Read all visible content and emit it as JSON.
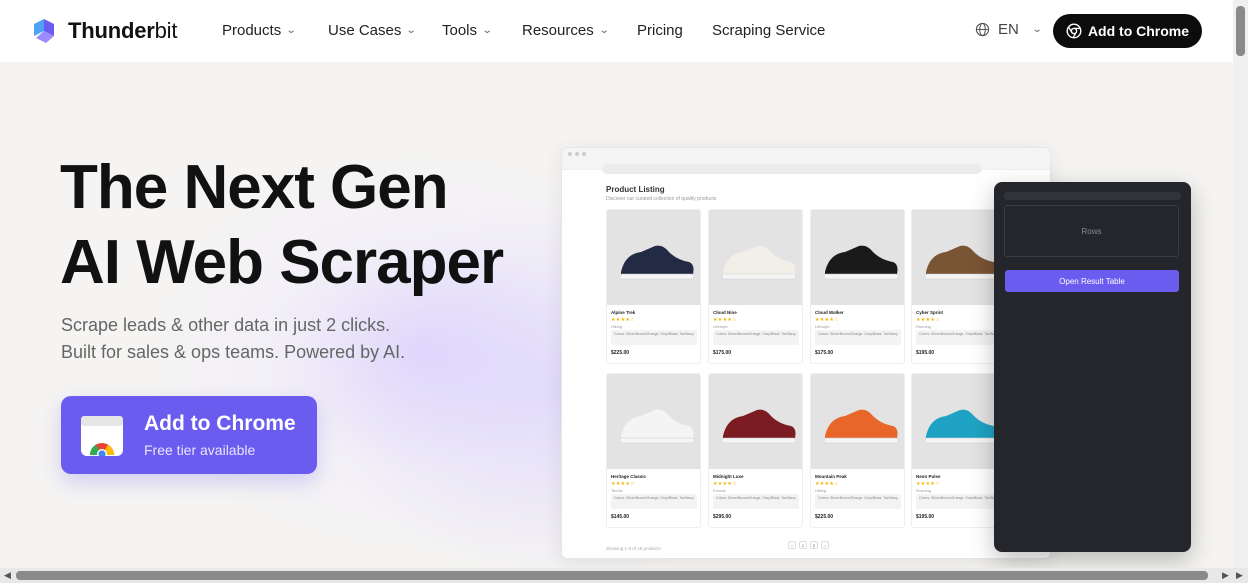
{
  "nav": {
    "brand_bold": "Thunder",
    "brand_light": "bit",
    "items": [
      {
        "label": "Products",
        "dropdown": true
      },
      {
        "label": "Use Cases",
        "dropdown": true
      },
      {
        "label": "Tools",
        "dropdown": true
      },
      {
        "label": "Resources",
        "dropdown": true
      },
      {
        "label": "Pricing",
        "dropdown": false
      },
      {
        "label": "Scraping Service",
        "dropdown": false
      }
    ],
    "language": "EN",
    "cta_label": "Add to Chrome"
  },
  "hero": {
    "title_line1": "The Next Gen",
    "title_line2": "AI Web Scraper",
    "subtitle_line1": "Scrape leads & other data in just 2 clicks.",
    "subtitle_line2": "Built for sales & ops teams. Powered by AI.",
    "cta_title": "Add to Chrome",
    "cta_subtitle": "Free tier available"
  },
  "mock": {
    "title": "Product Listing",
    "description": "Discover our curated collection of quality products",
    "products": [
      {
        "name": "Alpine Trek",
        "category": "Hiking",
        "tags": "Colors: Silver/Brown/Orange, Gray/Black, Tan/Navy",
        "price": "$225.00",
        "color": "#222a44"
      },
      {
        "name": "Cloud Nine",
        "category": "Lifestyle",
        "tags": "Colors: Silver/Brown/Orange, Gray/Black, Tan/Navy",
        "price": "$175.00",
        "color": "#f2efe8"
      },
      {
        "name": "Cloud Walker",
        "category": "Lifestyle",
        "tags": "Colors: Silver/Brown/Orange, Gray/Black, Tan/Navy",
        "price": "$175.00",
        "color": "#1a1a1a"
      },
      {
        "name": "Cyber Sprint",
        "category": "Running",
        "tags": "Colors: Silver/Brown/Orange, Gray/Black, Tan/Navy",
        "price": "$195.00",
        "color": "#7a5534"
      },
      {
        "name": "Heritage Classic",
        "category": "Tennis",
        "tags": "Colors: Silver/Brown/Orange, Gray/Black, Tan/Navy",
        "price": "$145.00",
        "color": "#f4f4f4"
      },
      {
        "name": "Midnight Luxe",
        "category": "Formal",
        "tags": "Colors: Silver/Brown/Orange, Gray/Black, Tan/Navy",
        "price": "$295.00",
        "color": "#7a1c22"
      },
      {
        "name": "Mountain Peak",
        "category": "Hiking",
        "tags": "Colors: Silver/Brown/Orange, Gray/Black, Tan/Navy",
        "price": "$225.00",
        "color": "#e8662a"
      },
      {
        "name": "Neon Pulse",
        "category": "Running",
        "tags": "Colors: Silver/Brown/Orange, Gray/Black, Tan/Navy",
        "price": "$195.00",
        "color": "#1fa3c4"
      }
    ],
    "footer": "Showing 1-8 of 16 products",
    "pages": [
      "‹",
      "1",
      "2",
      "›"
    ]
  },
  "panel": {
    "rows_label": "Rows",
    "open_button": "Open Result Table"
  },
  "colors": {
    "accent": "#6b5cf0",
    "dark": "#0c0c0c",
    "panel": "#25252c"
  }
}
